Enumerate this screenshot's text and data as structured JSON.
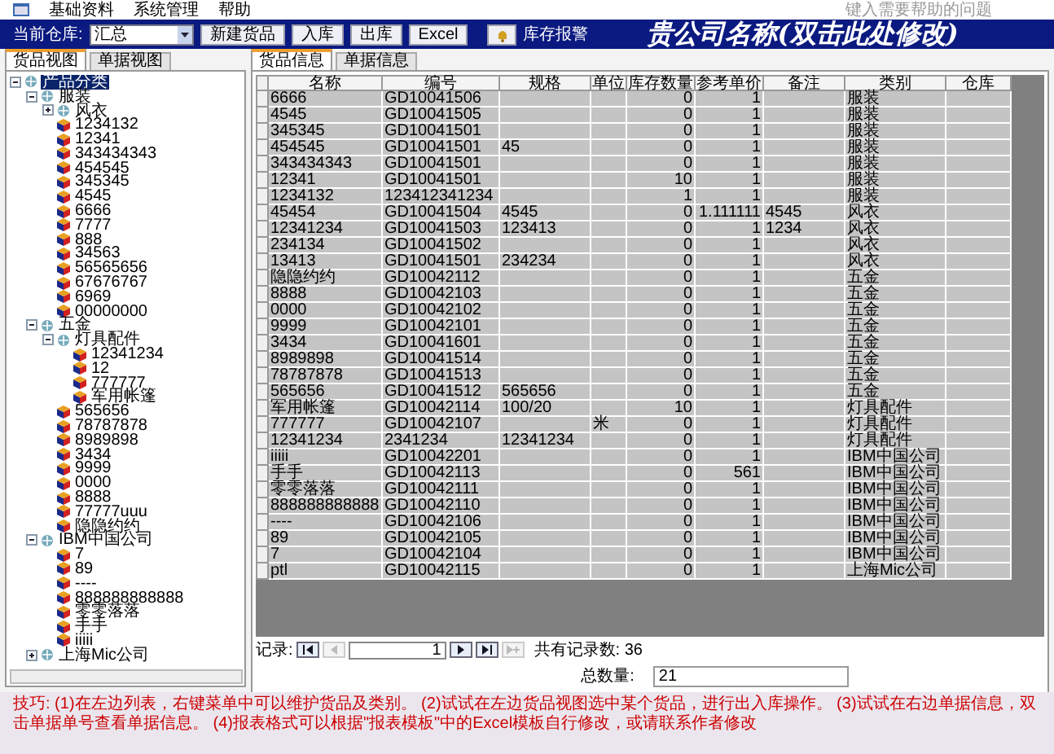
{
  "menu": {
    "items": [
      "基础资料",
      "系统管理",
      "帮助"
    ],
    "help_search": {
      "placeholder": "键入需要帮助的问题"
    }
  },
  "toolbar": {
    "warehouse_label": "当前仓库:",
    "warehouse_value": "汇总",
    "buttons": [
      "新建货品",
      "入库",
      "出库",
      "Excel"
    ],
    "alarm_label": "库存报警",
    "company_title": "贵公司名称(双击此处修改)"
  },
  "left_tabs": [
    {
      "label": "货品视图",
      "selected": true
    },
    {
      "label": "单据视图",
      "selected": false
    }
  ],
  "tree": [
    {
      "label": "产品分类",
      "kind": "root",
      "selected": true,
      "expanded": true,
      "children": [
        {
          "label": "服装",
          "kind": "group",
          "selected": false,
          "expanded": true,
          "children": [
            {
              "label": "风衣",
              "kind": "group",
              "selected": false,
              "expanded": false
            },
            {
              "label": "1234132",
              "kind": "item",
              "selected": false
            },
            {
              "label": "12341",
              "kind": "item",
              "selected": false
            },
            {
              "label": "343434343",
              "kind": "item",
              "selected": false
            },
            {
              "label": "454545",
              "kind": "item",
              "selected": false
            },
            {
              "label": "345345",
              "kind": "item",
              "selected": false
            },
            {
              "label": "4545",
              "kind": "item",
              "selected": false
            },
            {
              "label": "6666",
              "kind": "item",
              "selected": false
            },
            {
              "label": "7777",
              "kind": "item",
              "selected": false
            },
            {
              "label": "888",
              "kind": "item",
              "selected": false
            },
            {
              "label": "34563",
              "kind": "item",
              "selected": false
            },
            {
              "label": "56565656",
              "kind": "item",
              "selected": false
            },
            {
              "label": "67676767",
              "kind": "item",
              "selected": false
            },
            {
              "label": "6969",
              "kind": "item",
              "selected": false
            },
            {
              "label": "00000000",
              "kind": "item",
              "selected": false
            }
          ]
        },
        {
          "label": "五金",
          "kind": "group",
          "selected": false,
          "expanded": true,
          "children": [
            {
              "label": "灯具配件",
              "kind": "group",
              "selected": false,
              "expanded": true,
              "children": [
                {
                  "label": "12341234",
                  "kind": "item",
                  "selected": false
                },
                {
                  "label": "12",
                  "kind": "item",
                  "selected": false
                },
                {
                  "label": "777777",
                  "kind": "item",
                  "selected": false
                },
                {
                  "label": "军用帐篷",
                  "kind": "item",
                  "selected": false
                }
              ]
            },
            {
              "label": "565656",
              "kind": "item",
              "selected": false
            },
            {
              "label": "78787878",
              "kind": "item",
              "selected": false
            },
            {
              "label": "8989898",
              "kind": "item",
              "selected": false
            },
            {
              "label": "3434",
              "kind": "item",
              "selected": false
            },
            {
              "label": "9999",
              "kind": "item",
              "selected": false
            },
            {
              "label": "0000",
              "kind": "item",
              "selected": false
            },
            {
              "label": "8888",
              "kind": "item",
              "selected": false
            },
            {
              "label": "77777uuu",
              "kind": "item",
              "selected": false
            },
            {
              "label": "隐隐约约",
              "kind": "item",
              "selected": false
            }
          ]
        },
        {
          "label": "IBM中国公司",
          "kind": "group",
          "selected": false,
          "expanded": true,
          "children": [
            {
              "label": "7",
              "kind": "item",
              "selected": false
            },
            {
              "label": "89",
              "kind": "item",
              "selected": false
            },
            {
              "label": "----",
              "kind": "item",
              "selected": false
            },
            {
              "label": "888888888888",
              "kind": "item",
              "selected": false
            },
            {
              "label": "零零落落",
              "kind": "item",
              "selected": false
            },
            {
              "label": "手手",
              "kind": "item",
              "selected": false
            },
            {
              "label": "iiiii",
              "kind": "item",
              "selected": false
            }
          ]
        },
        {
          "label": "上海Mic公司",
          "kind": "group",
          "selected": false,
          "expanded": false
        }
      ]
    }
  ],
  "right_tabs": [
    {
      "label": "货品信息",
      "selected": true
    },
    {
      "label": "单据信息",
      "selected": false
    }
  ],
  "table": {
    "columns": [
      "名称",
      "编号",
      "规格",
      "单位",
      "库存数量",
      "参考单价",
      "备注",
      "类别",
      "仓库"
    ],
    "rows": [
      {
        "name": "6666",
        "code": "GD10041506",
        "stock": "0",
        "price": "1",
        "category": "服装"
      },
      {
        "name": "4545",
        "code": "GD10041505",
        "stock": "0",
        "price": "1",
        "category": "服装"
      },
      {
        "name": "345345",
        "code": "GD10041501",
        "stock": "0",
        "price": "1",
        "category": "服装"
      },
      {
        "name": "454545",
        "code": "GD10041501",
        "spec": "45",
        "stock": "0",
        "price": "1",
        "category": "服装"
      },
      {
        "name": "343434343",
        "code": "GD10041501",
        "stock": "0",
        "price": "1",
        "category": "服装"
      },
      {
        "name": "12341",
        "code": "GD10041501",
        "stock": "10",
        "price": "1",
        "category": "服装"
      },
      {
        "name": "1234132",
        "code": "123412341234",
        "stock": "1",
        "price": "1",
        "category": "服装"
      },
      {
        "name": "45454",
        "code": "GD10041504",
        "spec": "4545",
        "stock": "0",
        "price": "1.111111",
        "note": "4545",
        "category": "风衣"
      },
      {
        "name": "12341234",
        "code": "GD10041503",
        "spec": "123413",
        "stock": "0",
        "price": "1",
        "note": "1234",
        "category": "风衣"
      },
      {
        "name": "234134",
        "code": "GD10041502",
        "stock": "0",
        "price": "1",
        "category": "风衣"
      },
      {
        "name": "13413",
        "code": "GD10041501",
        "spec": "234234",
        "stock": "0",
        "price": "1",
        "category": "风衣"
      },
      {
        "name": "隐隐约约",
        "code": "GD10042112",
        "stock": "0",
        "price": "1",
        "category": "五金"
      },
      {
        "name": "8888",
        "code": "GD10042103",
        "stock": "0",
        "price": "1",
        "category": "五金"
      },
      {
        "name": "0000",
        "code": "GD10042102",
        "stock": "0",
        "price": "1",
        "category": "五金"
      },
      {
        "name": "9999",
        "code": "GD10042101",
        "stock": "0",
        "price": "1",
        "category": "五金"
      },
      {
        "name": "3434",
        "code": "GD10041601",
        "stock": "0",
        "price": "1",
        "category": "五金"
      },
      {
        "name": "8989898",
        "code": "GD10041514",
        "stock": "0",
        "price": "1",
        "category": "五金"
      },
      {
        "name": "78787878",
        "code": "GD10041513",
        "stock": "0",
        "price": "1",
        "category": "五金"
      },
      {
        "name": "565656",
        "code": "GD10041512",
        "spec": "565656",
        "stock": "0",
        "price": "1",
        "category": "五金"
      },
      {
        "name": "军用帐篷",
        "code": "GD10042114",
        "spec": "100/20",
        "stock": "10",
        "price": "1",
        "category": "灯具配件"
      },
      {
        "name": "777777",
        "code": "GD10042107",
        "unit": "米",
        "stock": "0",
        "price": "1",
        "category": "灯具配件"
      },
      {
        "name": "12341234",
        "code": "2341234",
        "spec": "12341234",
        "stock": "0",
        "price": "1",
        "category": "灯具配件"
      },
      {
        "name": "iiiii",
        "code": "GD10042201",
        "stock": "0",
        "price": "1",
        "category": "IBM中国公司"
      },
      {
        "name": "手手",
        "code": "GD10042113",
        "stock": "0",
        "price": "561",
        "category": "IBM中国公司"
      },
      {
        "name": "零零落落",
        "code": "GD10042111",
        "stock": "0",
        "price": "1",
        "category": "IBM中国公司"
      },
      {
        "name": "888888888888",
        "code": "GD10042110",
        "stock": "0",
        "price": "1",
        "category": "IBM中国公司"
      },
      {
        "name": "----",
        "code": "GD10042106",
        "stock": "0",
        "price": "1",
        "category": "IBM中国公司"
      },
      {
        "name": "89",
        "code": "GD10042105",
        "stock": "0",
        "price": "1",
        "category": "IBM中国公司"
      },
      {
        "name": "7",
        "code": "GD10042104",
        "stock": "0",
        "price": "1",
        "category": "IBM中国公司"
      },
      {
        "name": "ptl",
        "code": "GD10042115",
        "stock": "0",
        "price": "1",
        "category": "上海Mic公司"
      }
    ]
  },
  "navigator": {
    "label": "记录:",
    "current": "1",
    "count_text": "共有记录数: 36"
  },
  "total": {
    "label": "总数量:",
    "value": "21"
  },
  "tip": "技巧: (1)在左边列表，右键菜单中可以维护货品及类别。 (2)试试在左边货品视图选中某个货品，进行出入库操作。 (3)试试在右边单据信息，双击单据单号查看单据信息。 (4)报表格式可以根据\"报表模板\"中的Excel模板自行修改，或请联系作者修改"
}
